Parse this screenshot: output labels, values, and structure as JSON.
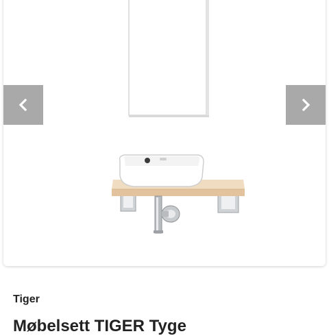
{
  "gallery": {
    "image_alt": "Møbelsett TIGER Tyge",
    "prev_icon": "chevron-left-icon",
    "next_icon": "chevron-right-icon"
  },
  "product": {
    "brand": "Tiger",
    "title": "Møbelsett TIGER Tyge"
  },
  "colors": {
    "nav_button_bg": "#8c8c8c",
    "text": "#222222",
    "shelf": "#e9cfae"
  }
}
